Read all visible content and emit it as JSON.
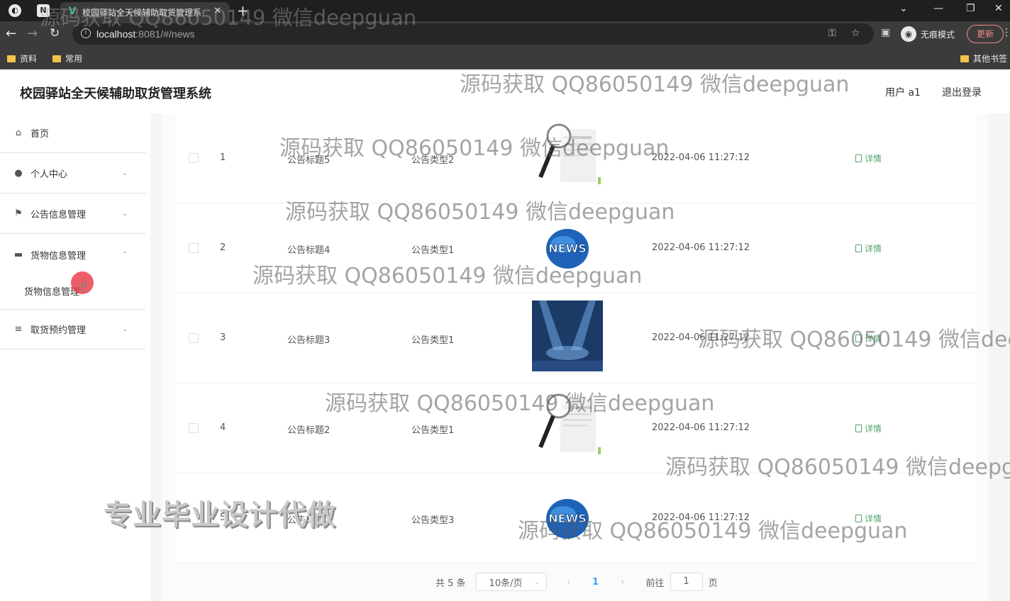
{
  "browser": {
    "tab_title": "校园驿站全天候辅助取货管理系",
    "url_host": "localhost",
    "url_rest": ":8081/#/news",
    "incognito_label": "无痕模式",
    "update_label": "更新",
    "bookmarks": [
      "资料",
      "常用",
      "其他书签"
    ]
  },
  "app": {
    "title": "校园驿站全天候辅助取货管理系统",
    "user_label": "用户 a1",
    "logout_label": "退出登录"
  },
  "sidebar": {
    "items": [
      {
        "label": "首页",
        "icon": "home-icon"
      },
      {
        "label": "个人中心",
        "icon": "user-icon"
      },
      {
        "label": "公告信息管理",
        "icon": "flag-icon"
      },
      {
        "label": "货物信息管理",
        "icon": "ticket-icon"
      },
      {
        "label": "取货预约管理",
        "icon": "list-icon"
      }
    ],
    "submenu_label": "货物信息管理"
  },
  "table": {
    "rows": [
      {
        "index": "1",
        "title": "公告标题5",
        "type": "公告类型2",
        "time": "2022-04-06 11:27:12",
        "action": "详情",
        "image": "magnifier-news"
      },
      {
        "index": "2",
        "title": "公告标题4",
        "type": "公告类型1",
        "time": "2022-04-06 11:27:12",
        "action": "详情",
        "image": "news-globe"
      },
      {
        "index": "3",
        "title": "公告标题3",
        "type": "公告类型1",
        "time": "2022-04-06 11:27:12",
        "action": "详情",
        "image": "stage-spotlight"
      },
      {
        "index": "4",
        "title": "公告标题2",
        "type": "公告类型1",
        "time": "2022-04-06 11:27:12",
        "action": "详情",
        "image": "magnifier-news"
      },
      {
        "index": "5",
        "title": "公告标题1",
        "type": "公告类型3",
        "time": "2022-04-06 11:27:12",
        "action": "详情",
        "image": "news-globe"
      }
    ]
  },
  "pagination": {
    "total_label": "共 5 条",
    "page_size": "10条/页",
    "current_page": "1",
    "goto_label": "前往",
    "goto_value": "1",
    "page_suffix": "页"
  },
  "watermark": "源码获取 QQ86050149 微信deepguan",
  "promo": "专业毕业设计代做",
  "colors": {
    "accent": "#409eff",
    "detail_green": "#52a36c",
    "cursor_red": "#ea434d"
  }
}
